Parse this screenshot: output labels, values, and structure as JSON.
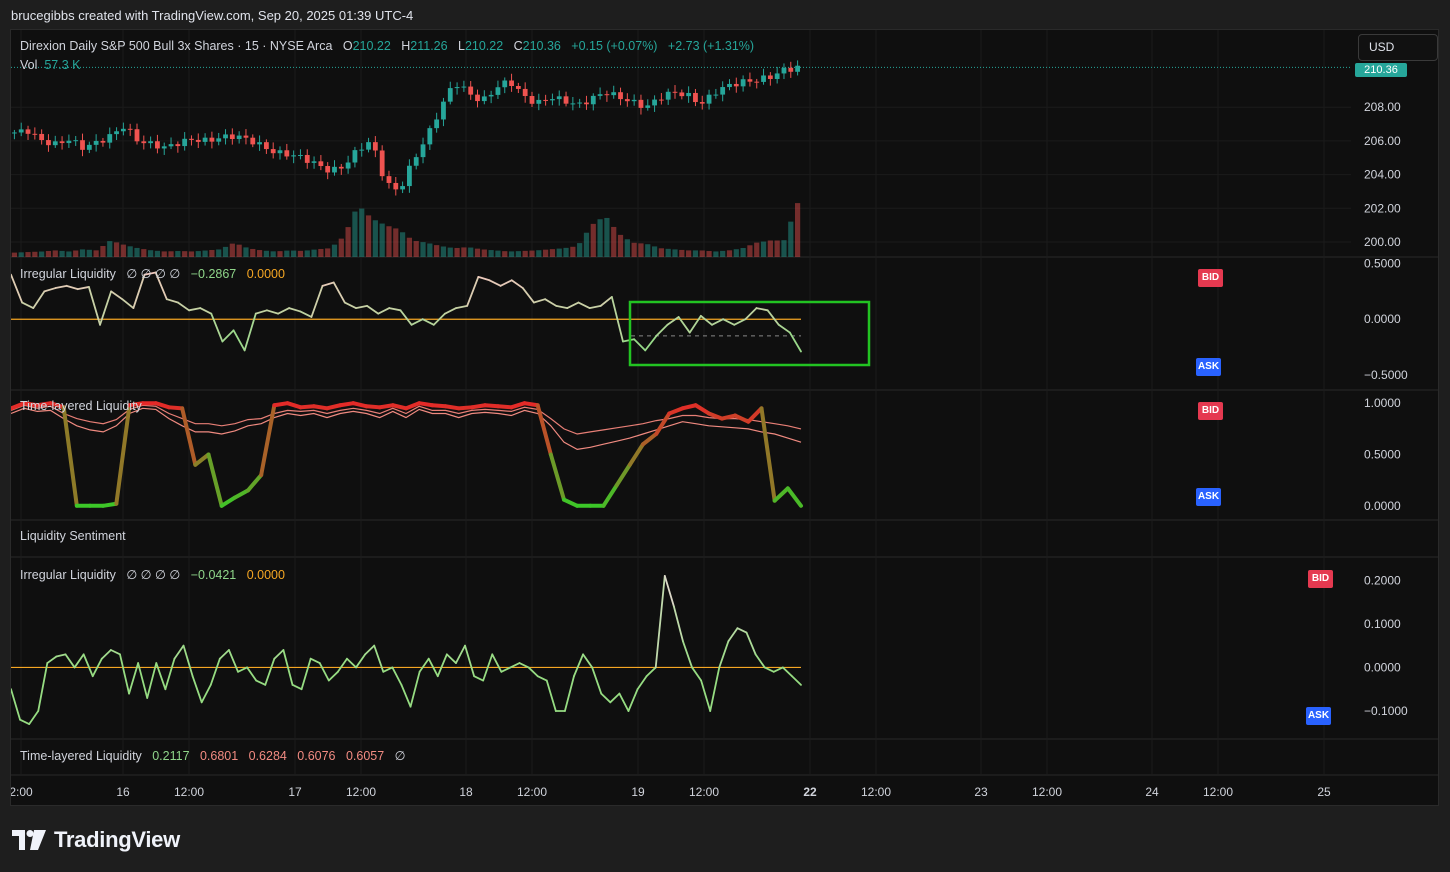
{
  "attribution": "brucegibbs created with TradingView.com, Sep 20, 2025 01:39 UTC-4",
  "currency_button": "USD",
  "last_price_tag": "210.36",
  "footer": {
    "brand": "TradingView",
    "logo_icon": "tradingview-logo-icon"
  },
  "colors": {
    "up": "#26a69a",
    "down": "#ef5350",
    "bid": "#e53950",
    "ask": "#2962ff",
    "zero_line": "#f5a623",
    "highlight_box": "#22c322"
  },
  "main_pane": {
    "symbol": "Direxion Daily S&P 500 Bull 3x Shares · 15 · NYSE Arca",
    "o_label": "O",
    "o": "210.22",
    "h_label": "H",
    "h": "211.26",
    "l_label": "L",
    "l": "210.22",
    "c_label": "C",
    "c": "210.36",
    "change": "+0.15 (+0.07%)",
    "change2": "+2.73 (+1.31%)",
    "vol_label": "Vol",
    "vol": "57.3 K"
  },
  "pane2": {
    "title": "Irregular Liquidity",
    "placeholders": "∅  ∅  ∅  ∅",
    "value": "−0.2867",
    "zero": "0.0000",
    "bid": "BID",
    "ask": "ASK"
  },
  "pane3": {
    "title": "Time-layered Liquidity",
    "bid": "BID",
    "ask": "ASK"
  },
  "pane4": {
    "title": "Liquidity Sentiment"
  },
  "pane5": {
    "title": "Irregular Liquidity",
    "placeholders": "∅  ∅  ∅  ∅",
    "value": "−0.0421",
    "zero": "0.0000",
    "bid": "BID",
    "ask": "ASK"
  },
  "pane6": {
    "title": "Time-layered Liquidity",
    "values": [
      "0.2117",
      "0.6801",
      "0.6284",
      "0.6076",
      "0.6057"
    ],
    "placeholder": "∅"
  },
  "chart_data": [
    {
      "type": "candlestick",
      "title": "Direxion Daily S&P 500 Bull 3x Shares · 15 · NYSE Arca",
      "y_ticks": [
        "200.00",
        "202.00",
        "204.00",
        "206.00",
        "208.00",
        "210.36"
      ],
      "ylim": [
        199.4,
        211.8
      ],
      "x_ticks": [
        "2:00",
        "16",
        "12:00",
        "17",
        "12:00",
        "18",
        "12:00",
        "19",
        "12:00",
        "22",
        "12:00",
        "23",
        "12:00",
        "24",
        "12:00",
        "25"
      ],
      "close_path": [
        206.5,
        206.6,
        206.0,
        205.8,
        206.1,
        205.6,
        205.9,
        206.3,
        206.9,
        206.0,
        205.8,
        205.6,
        205.9,
        206.1,
        206.0,
        206.2,
        206.3,
        206.1,
        205.7,
        205.3,
        205.2,
        205.0,
        204.6,
        204.2,
        204.5,
        205.5,
        206.0,
        203.5,
        203.0,
        204.8,
        206.2,
        207.9,
        209.5,
        208.9,
        208.3,
        209.1,
        209.6,
        208.7,
        208.2,
        208.6,
        208.4,
        208.1,
        208.5,
        208.9,
        208.6,
        208.3,
        208.0,
        208.6,
        208.9,
        208.7,
        208.2,
        208.9,
        209.3,
        209.5,
        209.6,
        209.8,
        210.2,
        210.36
      ],
      "volume_path": [
        0.08,
        0.09,
        0.1,
        0.12,
        0.1,
        0.14,
        0.12,
        0.3,
        0.22,
        0.16,
        0.12,
        0.1,
        0.11,
        0.1,
        0.12,
        0.14,
        0.26,
        0.16,
        0.12,
        0.1,
        0.12,
        0.11,
        0.14,
        0.16,
        0.38,
        0.95,
        0.7,
        0.58,
        0.5,
        0.3,
        0.26,
        0.2,
        0.16,
        0.18,
        0.14,
        0.12,
        0.1,
        0.11,
        0.12,
        0.14,
        0.16,
        0.2,
        0.58,
        0.75,
        0.42,
        0.26,
        0.24,
        0.16,
        0.14,
        0.12,
        0.12,
        0.1,
        0.12,
        0.16,
        0.26,
        0.3,
        0.3,
        0.98
      ]
    },
    {
      "type": "line",
      "title": "Irregular Liquidity",
      "y_ticks": [
        "0.5000",
        "0.0000",
        "−0.5000"
      ],
      "ylim": [
        -0.6,
        0.55
      ],
      "highlight_box": true,
      "values": [
        0.4,
        0.15,
        0.1,
        0.25,
        0.28,
        0.3,
        0.27,
        0.29,
        -0.05,
        0.25,
        0.18,
        0.1,
        0.4,
        0.42,
        0.18,
        0.15,
        0.08,
        0.1,
        0.05,
        -0.2,
        -0.1,
        -0.28,
        0.05,
        0.08,
        0.05,
        0.1,
        0.07,
        0.02,
        0.3,
        0.33,
        0.15,
        0.1,
        0.12,
        0.05,
        0.1,
        0.08,
        -0.05,
        0.0,
        -0.05,
        0.05,
        0.1,
        0.12,
        0.38,
        0.35,
        0.3,
        0.35,
        0.28,
        0.15,
        0.18,
        0.12,
        0.1,
        0.15,
        0.1,
        0.12,
        0.2,
        -0.2,
        -0.18,
        -0.28,
        -0.15,
        -0.05,
        0.02,
        -0.12,
        0.03,
        -0.05,
        0.0,
        -0.05,
        0.0,
        0.1,
        0.08,
        -0.05,
        -0.12,
        -0.29
      ]
    },
    {
      "type": "line",
      "title": "Time-layered Liquidity",
      "y_ticks": [
        "1.0000",
        "0.5000",
        "0.0000"
      ],
      "ylim": [
        -0.08,
        1.08
      ],
      "series": [
        {
          "values": [
            0.95,
            1.0,
            0.98,
            1.0,
            0.96,
            0.0,
            0.0,
            0.0,
            0.02,
            0.98,
            1.0,
            1.0,
            0.96,
            0.95,
            0.4,
            0.5,
            0.0,
            0.08,
            0.15,
            0.3,
            0.98,
            1.0,
            0.96,
            0.97,
            0.95,
            0.98,
            1.0,
            0.97,
            0.96,
            0.98,
            0.95,
            1.0,
            0.98,
            0.97,
            0.95,
            0.96,
            0.98,
            0.97,
            0.96,
            1.0,
            0.98,
            0.5,
            0.06,
            0.0,
            0.0,
            0.0,
            0.2,
            0.4,
            0.6,
            0.7,
            0.9,
            0.95,
            0.98,
            0.9,
            0.85,
            0.88,
            0.82,
            0.95,
            0.05,
            0.17,
            0.0
          ]
        },
        {
          "values": [
            0.93,
            0.98,
            0.95,
            0.97,
            0.9,
            0.85,
            0.82,
            0.8,
            0.84,
            0.94,
            0.98,
            0.97,
            0.9,
            0.85,
            0.8,
            0.8,
            0.78,
            0.8,
            0.84,
            0.85,
            0.9,
            0.93,
            0.92,
            0.93,
            0.9,
            0.93,
            0.95,
            0.93,
            0.9,
            0.95,
            0.9,
            0.97,
            0.93,
            0.93,
            0.9,
            0.93,
            0.94,
            0.93,
            0.92,
            0.96,
            0.94,
            0.85,
            0.75,
            0.7,
            0.72,
            0.74,
            0.76,
            0.78,
            0.8,
            0.83,
            0.85,
            0.88,
            0.88,
            0.86,
            0.85,
            0.85,
            0.84,
            0.82,
            0.8,
            0.78,
            0.75
          ]
        },
        {
          "values": [
            0.9,
            0.95,
            0.92,
            0.93,
            0.85,
            0.78,
            0.74,
            0.72,
            0.78,
            0.9,
            0.95,
            0.94,
            0.85,
            0.78,
            0.72,
            0.72,
            0.7,
            0.73,
            0.78,
            0.8,
            0.86,
            0.9,
            0.88,
            0.9,
            0.86,
            0.9,
            0.92,
            0.9,
            0.86,
            0.92,
            0.86,
            0.94,
            0.9,
            0.9,
            0.86,
            0.9,
            0.91,
            0.9,
            0.88,
            0.93,
            0.9,
            0.78,
            0.62,
            0.55,
            0.57,
            0.6,
            0.63,
            0.66,
            0.7,
            0.74,
            0.78,
            0.82,
            0.8,
            0.78,
            0.77,
            0.76,
            0.75,
            0.72,
            0.7,
            0.66,
            0.62
          ]
        }
      ]
    },
    {
      "type": "line",
      "title": "Irregular Liquidity",
      "y_ticks": [
        "0.2000",
        "0.1000",
        "0.0000",
        "−0.1000"
      ],
      "ylim": [
        -0.155,
        0.235
      ],
      "values": [
        -0.05,
        -0.12,
        -0.13,
        -0.1,
        0.01,
        0.025,
        0.03,
        0.0,
        0.03,
        -0.02,
        0.02,
        0.04,
        0.03,
        -0.06,
        0.01,
        -0.07,
        0.01,
        -0.05,
        0.02,
        0.05,
        -0.02,
        -0.08,
        -0.04,
        0.02,
        0.04,
        -0.01,
        0.0,
        -0.03,
        -0.04,
        0.02,
        0.04,
        -0.04,
        -0.05,
        0.02,
        0.01,
        -0.03,
        -0.01,
        0.02,
        0.0,
        0.03,
        0.05,
        -0.01,
        0.0,
        -0.04,
        -0.09,
        -0.01,
        0.02,
        -0.02,
        0.03,
        0.01,
        0.05,
        -0.02,
        -0.03,
        0.03,
        -0.01,
        0.0,
        0.01,
        0.0,
        -0.02,
        -0.03,
        -0.1,
        -0.1,
        -0.02,
        0.03,
        0.0,
        -0.06,
        -0.08,
        -0.06,
        -0.1,
        -0.05,
        -0.02,
        0.0,
        0.21,
        0.14,
        0.06,
        0.0,
        -0.03,
        -0.1,
        0.0,
        0.06,
        0.09,
        0.08,
        0.03,
        0.0,
        -0.01,
        0.0,
        -0.02,
        -0.04
      ]
    }
  ]
}
